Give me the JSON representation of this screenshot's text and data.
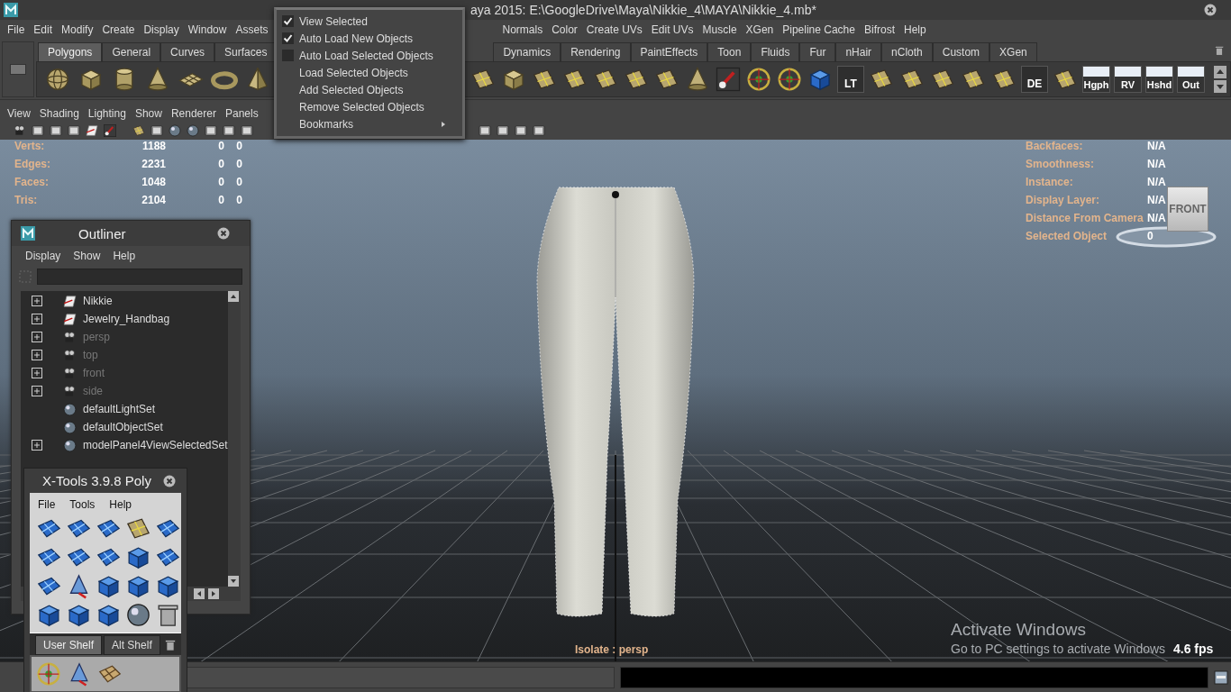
{
  "window": {
    "title": "aya 2015: E:\\GoogleDrive\\Maya\\Nikkie_4\\MAYA\\Nikkie_4.mb*"
  },
  "menu_bar": {
    "left": [
      "File",
      "Edit",
      "Modify",
      "Create",
      "Display",
      "Window",
      "Assets"
    ],
    "right": [
      "Normals",
      "Color",
      "Create UVs",
      "Edit UVs",
      "Muscle",
      "XGen",
      "Pipeline Cache",
      "Bifrost",
      "Help"
    ]
  },
  "shelf": {
    "tabs_left": [
      {
        "label": "Polygons",
        "selected": true
      },
      {
        "label": "General",
        "selected": false
      },
      {
        "label": "Curves",
        "selected": false
      },
      {
        "label": "Surfaces",
        "selected": false
      }
    ],
    "tabs_right": [
      {
        "label": "Dynamics",
        "selected": false
      },
      {
        "label": "Rendering",
        "selected": false
      },
      {
        "label": "PaintEffects",
        "selected": false
      },
      {
        "label": "Toon",
        "selected": false
      },
      {
        "label": "Fluids",
        "selected": false
      },
      {
        "label": "Fur",
        "selected": false
      },
      {
        "label": "nHair",
        "selected": false
      },
      {
        "label": "nCloth",
        "selected": false
      },
      {
        "label": "Custom",
        "selected": false
      },
      {
        "label": "XGen",
        "selected": false
      }
    ],
    "text_buttons": [
      "LT",
      "DE",
      "Hgph",
      "RV",
      "Hshd",
      "Out"
    ]
  },
  "panel_menu": [
    "View",
    "Shading",
    "Lighting",
    "Show",
    "Renderer",
    "Panels"
  ],
  "hud_left": [
    {
      "label": "Verts:",
      "values": [
        "1188",
        "0",
        "0"
      ]
    },
    {
      "label": "Edges:",
      "values": [
        "2231",
        "0",
        "0"
      ]
    },
    {
      "label": "Faces:",
      "values": [
        "1048",
        "0",
        "0"
      ]
    },
    {
      "label": "Tris:",
      "values": [
        "2104",
        "0",
        "0"
      ]
    }
  ],
  "hud_right": [
    {
      "label": "Backfaces:",
      "value": "N/A"
    },
    {
      "label": "Smoothness:",
      "value": "N/A"
    },
    {
      "label": "Instance:",
      "value": "N/A"
    },
    {
      "label": "Display Layer:",
      "value": "N/A"
    },
    {
      "label": "Distance From Camera",
      "value": "N/A"
    },
    {
      "label": "Selected Object",
      "value": "0"
    }
  ],
  "view_cube": {
    "label": "FRONT"
  },
  "viewport": {
    "isolate_label": "Isolate : persp",
    "fps": "4.6 fps"
  },
  "system_notice": {
    "title": "Activate Windows",
    "text": "Go to PC settings to activate Windows"
  },
  "outliner": {
    "title": "Outliner",
    "menus": [
      "Display",
      "Show",
      "Help"
    ],
    "items": [
      {
        "label": "Nikkie",
        "kind": "transform",
        "expander": true,
        "hidden": false
      },
      {
        "label": "Jewelry_Handbag",
        "kind": "transform",
        "expander": true,
        "hidden": false
      },
      {
        "label": "persp",
        "kind": "camera",
        "expander": true,
        "hidden": true
      },
      {
        "label": "top",
        "kind": "camera",
        "expander": true,
        "hidden": true
      },
      {
        "label": "front",
        "kind": "camera",
        "expander": true,
        "hidden": true
      },
      {
        "label": "side",
        "kind": "camera",
        "expander": true,
        "hidden": true
      },
      {
        "label": "defaultLightSet",
        "kind": "set",
        "expander": false,
        "hidden": false
      },
      {
        "label": "defaultObjectSet",
        "kind": "set",
        "expander": false,
        "hidden": false
      },
      {
        "label": "modelPanel4ViewSelectedSet",
        "kind": "set",
        "expander": true,
        "hidden": false
      }
    ]
  },
  "xtools": {
    "title": "X-Tools 3.9.8 Poly",
    "menus": [
      "File",
      "Tools",
      "Help"
    ],
    "tabs": [
      {
        "label": "User Shelf",
        "selected": true
      },
      {
        "label": "Alt Shelf",
        "selected": false
      }
    ]
  },
  "isolate_menu": {
    "items": [
      {
        "label": "View Selected",
        "kind": "check",
        "checked": true
      },
      {
        "label": "Auto Load New Objects",
        "kind": "check",
        "checked": true
      },
      {
        "label": "Auto Load Selected Objects",
        "kind": "check",
        "checked": false
      },
      {
        "label": "Load Selected Objects",
        "kind": "action"
      },
      {
        "label": "Add Selected Objects",
        "kind": "action"
      },
      {
        "label": "Remove Selected Objects",
        "kind": "action"
      },
      {
        "label": "Bookmarks",
        "kind": "submenu"
      }
    ]
  }
}
